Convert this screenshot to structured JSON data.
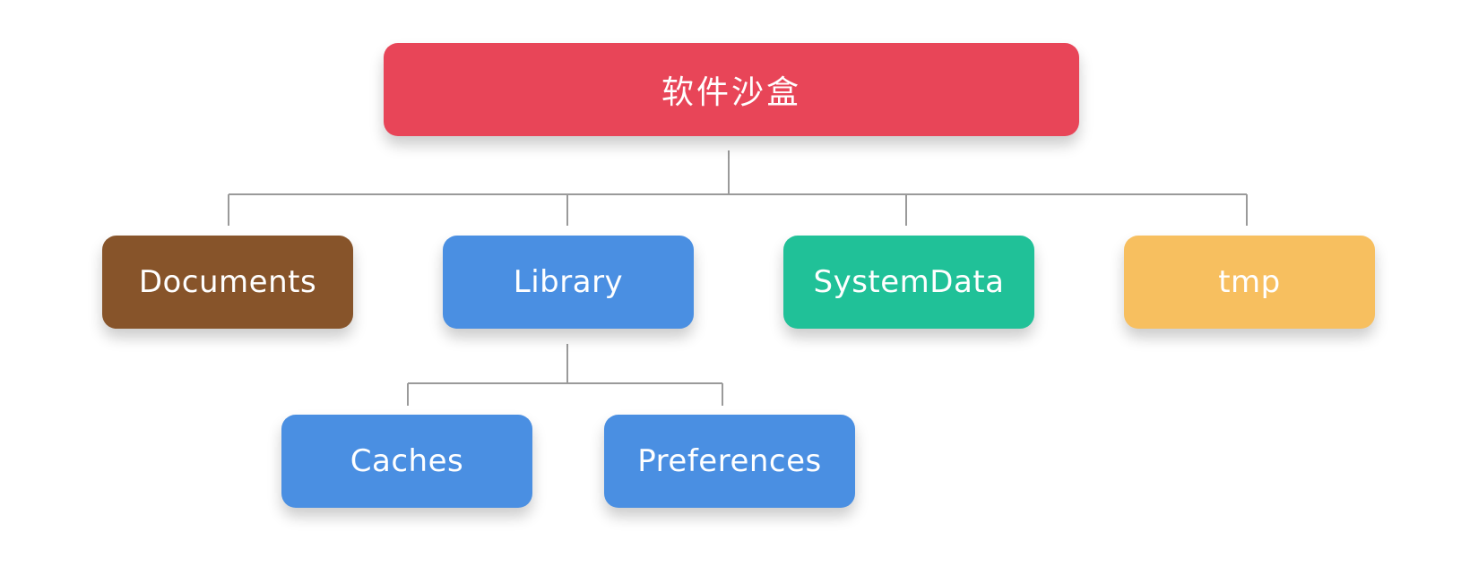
{
  "diagram": {
    "root": {
      "label": "软件沙盒",
      "color": "#E84558"
    },
    "children": [
      {
        "id": "documents",
        "label": "Documents",
        "color": "#87542A"
      },
      {
        "id": "library",
        "label": "Library",
        "color": "#4A8FE2"
      },
      {
        "id": "systemdata",
        "label": "SystemData",
        "color": "#20C198"
      },
      {
        "id": "tmp",
        "label": "tmp",
        "color": "#F7BF5F"
      }
    ],
    "library_children": [
      {
        "id": "caches",
        "label": "Caches",
        "color": "#4A8FE2"
      },
      {
        "id": "preferences",
        "label": "Preferences",
        "color": "#4A8FE2"
      }
    ],
    "connector_color": "#9A9A9A"
  }
}
